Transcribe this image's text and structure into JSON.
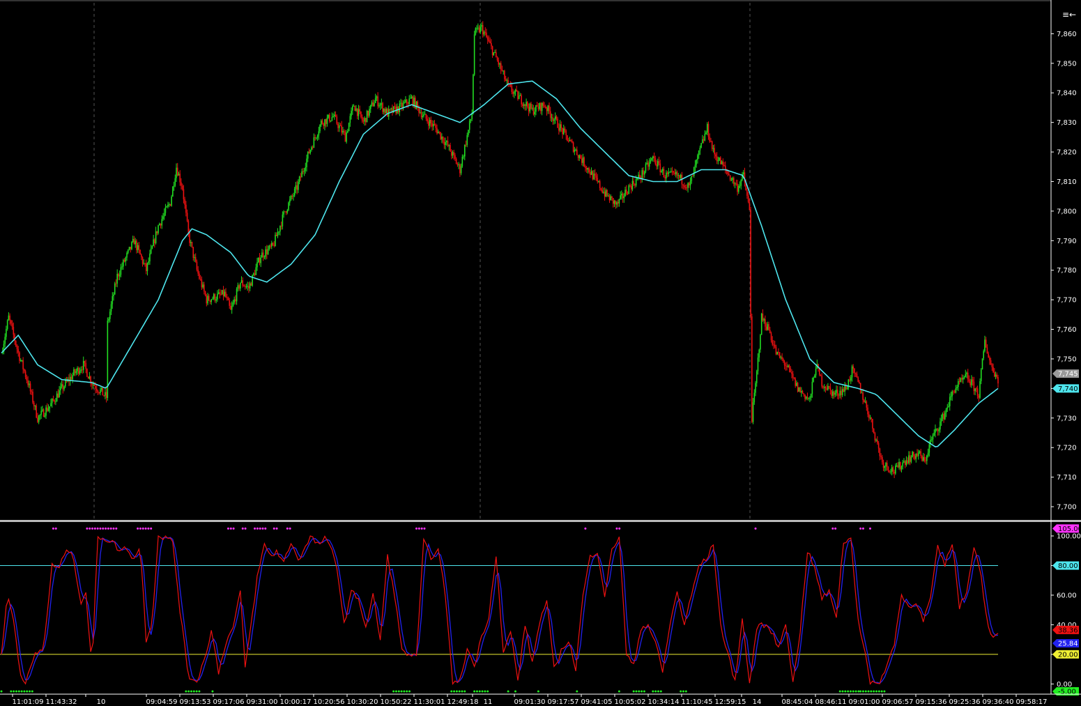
{
  "colors": {
    "background": "#000000",
    "up_candle": "#22dd22",
    "down_candle": "#ee1111",
    "moving_average": "#4ee6ee",
    "stoch_k": "#ee1111",
    "stoch_d": "#2222ee",
    "level_upper": "#4ee6ee",
    "level_lower": "#eeee33",
    "overbought_dots": "#ff33ff",
    "oversold_dots": "#22ee22",
    "separator": "#ffffff",
    "axis_text": "#ffffff",
    "vline": "#555555"
  },
  "toolbar": {
    "menu_icon": "≡←"
  },
  "chart_data": [
    {
      "type": "candlestick",
      "name": "",
      "ylim": [
        7696,
        7870
      ],
      "y_ticks": [
        "7,700",
        "7,710",
        "7,720",
        "7,730",
        "7,740",
        "7,750",
        "7,760",
        "7,770",
        "7,780",
        "7,790",
        "7,800",
        "7,810",
        "7,820",
        "7,830",
        "7,840",
        "7,850",
        "7,860"
      ],
      "y_tick_values": [
        7700,
        7710,
        7720,
        7730,
        7740,
        7750,
        7760,
        7770,
        7780,
        7790,
        7800,
        7810,
        7820,
        7830,
        7840,
        7850,
        7860
      ],
      "last_price_label": "7,745",
      "last_price_value": 7745,
      "ma_label": "7,740",
      "ma_value": 7740,
      "price_path": [
        [
          0,
          7752
        ],
        [
          6,
          7764
        ],
        [
          14,
          7752
        ],
        [
          22,
          7742
        ],
        [
          30,
          7730
        ],
        [
          40,
          7734
        ],
        [
          50,
          7740
        ],
        [
          60,
          7745
        ],
        [
          68,
          7748
        ],
        [
          75,
          7742
        ],
        [
          87,
          7737
        ],
        [
          88,
          7762
        ],
        [
          96,
          7778
        ],
        [
          110,
          7790
        ],
        [
          120,
          7780
        ],
        [
          130,
          7795
        ],
        [
          140,
          7803
        ],
        [
          145,
          7815
        ],
        [
          150,
          7808
        ],
        [
          155,
          7792
        ],
        [
          162,
          7780
        ],
        [
          170,
          7770
        ],
        [
          185,
          7772
        ],
        [
          190,
          7766
        ],
        [
          198,
          7776
        ],
        [
          205,
          7774
        ],
        [
          215,
          7785
        ],
        [
          225,
          7788
        ],
        [
          235,
          7800
        ],
        [
          245,
          7808
        ],
        [
          255,
          7820
        ],
        [
          265,
          7830
        ],
        [
          275,
          7832
        ],
        [
          285,
          7825
        ],
        [
          292,
          7836
        ],
        [
          300,
          7830
        ],
        [
          310,
          7838
        ],
        [
          320,
          7833
        ],
        [
          330,
          7835
        ],
        [
          340,
          7838
        ],
        [
          350,
          7832
        ],
        [
          360,
          7828
        ],
        [
          370,
          7822
        ],
        [
          380,
          7814
        ],
        [
          390,
          7833
        ],
        [
          392,
          7860
        ],
        [
          398,
          7862
        ],
        [
          405,
          7856
        ],
        [
          412,
          7850
        ],
        [
          420,
          7842
        ],
        [
          430,
          7838
        ],
        [
          440,
          7834
        ],
        [
          450,
          7836
        ],
        [
          460,
          7830
        ],
        [
          470,
          7824
        ],
        [
          480,
          7818
        ],
        [
          490,
          7812
        ],
        [
          500,
          7806
        ],
        [
          510,
          7802
        ],
        [
          520,
          7808
        ],
        [
          530,
          7812
        ],
        [
          540,
          7818
        ],
        [
          550,
          7812
        ],
        [
          560,
          7812
        ],
        [
          570,
          7808
        ],
        [
          580,
          7822
        ],
        [
          585,
          7828
        ],
        [
          590,
          7820
        ],
        [
          600,
          7814
        ],
        [
          610,
          7808
        ],
        [
          615,
          7812
        ],
        [
          620,
          7800
        ],
        [
          622,
          7730
        ],
        [
          626,
          7745
        ],
        [
          630,
          7764
        ],
        [
          636,
          7760
        ],
        [
          642,
          7752
        ],
        [
          650,
          7748
        ],
        [
          660,
          7740
        ],
        [
          670,
          7736
        ],
        [
          675,
          7748
        ],
        [
          680,
          7742
        ],
        [
          690,
          7738
        ],
        [
          700,
          7740
        ],
        [
          705,
          7746
        ],
        [
          710,
          7742
        ],
        [
          720,
          7730
        ],
        [
          730,
          7715
        ],
        [
          740,
          7712
        ],
        [
          750,
          7716
        ],
        [
          760,
          7718
        ],
        [
          765,
          7715
        ],
        [
          770,
          7722
        ],
        [
          780,
          7730
        ],
        [
          790,
          7740
        ],
        [
          800,
          7744
        ],
        [
          810,
          7738
        ],
        [
          815,
          7756
        ],
        [
          820,
          7748
        ],
        [
          826,
          7743
        ]
      ],
      "ma_path": [
        [
          0,
          7752
        ],
        [
          14,
          7758
        ],
        [
          30,
          7748
        ],
        [
          50,
          7743
        ],
        [
          75,
          7742
        ],
        [
          87,
          7740
        ],
        [
          110,
          7756
        ],
        [
          130,
          7770
        ],
        [
          150,
          7790
        ],
        [
          158,
          7794
        ],
        [
          170,
          7792
        ],
        [
          190,
          7786
        ],
        [
          205,
          7778
        ],
        [
          220,
          7776
        ],
        [
          240,
          7782
        ],
        [
          260,
          7792
        ],
        [
          280,
          7810
        ],
        [
          300,
          7826
        ],
        [
          320,
          7833
        ],
        [
          340,
          7836
        ],
        [
          360,
          7833
        ],
        [
          380,
          7830
        ],
        [
          400,
          7836
        ],
        [
          420,
          7843
        ],
        [
          440,
          7844
        ],
        [
          460,
          7838
        ],
        [
          480,
          7828
        ],
        [
          500,
          7820
        ],
        [
          520,
          7812
        ],
        [
          540,
          7810
        ],
        [
          560,
          7810
        ],
        [
          580,
          7814
        ],
        [
          600,
          7814
        ],
        [
          615,
          7812
        ],
        [
          630,
          7795
        ],
        [
          650,
          7770
        ],
        [
          670,
          7750
        ],
        [
          690,
          7742
        ],
        [
          710,
          7740
        ],
        [
          725,
          7738
        ],
        [
          740,
          7732
        ],
        [
          760,
          7724
        ],
        [
          775,
          7720
        ],
        [
          790,
          7726
        ],
        [
          810,
          7735
        ],
        [
          826,
          7740
        ]
      ]
    },
    {
      "type": "line",
      "name": "",
      "ylim": [
        -5,
        108
      ],
      "y_ticks": [
        "0.00",
        "20.00",
        "40.00",
        "60.00",
        "80.00",
        "100.00"
      ],
      "y_tick_values": [
        0,
        20,
        40,
        60,
        80,
        100
      ],
      "levels": [
        80,
        20
      ],
      "badges": [
        {
          "label": "105.00",
          "value": 105,
          "color": "#ff33ff"
        },
        {
          "label": "80.00",
          "value": 80,
          "color": "#4ee6ee"
        },
        {
          "label": "38.36",
          "value": 36.5,
          "color": "#ee1111"
        },
        {
          "label": "25.84",
          "value": 27.5,
          "color": "#2222ee"
        },
        {
          "label": "20.00",
          "value": 20,
          "color": "#eeee33"
        },
        {
          "label": "-5.00",
          "value": -5,
          "color": "#22ee22"
        }
      ],
      "series_k": [
        [
          0,
          20
        ],
        [
          5,
          60
        ],
        [
          10,
          45
        ],
        [
          15,
          10
        ],
        [
          20,
          0
        ],
        [
          28,
          20
        ],
        [
          35,
          24
        ],
        [
          42,
          80
        ],
        [
          48,
          78
        ],
        [
          54,
          92
        ],
        [
          60,
          84
        ],
        [
          66,
          55
        ],
        [
          70,
          62
        ],
        [
          75,
          10
        ],
        [
          80,
          100
        ],
        [
          86,
          98
        ],
        [
          92,
          96
        ],
        [
          98,
          90
        ],
        [
          104,
          92
        ],
        [
          110,
          84
        ],
        [
          115,
          94
        ],
        [
          120,
          30
        ],
        [
          125,
          42
        ],
        [
          130,
          100
        ],
        [
          136,
          99
        ],
        [
          142,
          96
        ],
        [
          148,
          50
        ],
        [
          155,
          5
        ],
        [
          162,
          2
        ],
        [
          168,
          16
        ],
        [
          174,
          36
        ],
        [
          180,
          8
        ],
        [
          186,
          28
        ],
        [
          192,
          38
        ],
        [
          198,
          62
        ],
        [
          202,
          12
        ],
        [
          206,
          34
        ],
        [
          212,
          72
        ],
        [
          218,
          94
        ],
        [
          224,
          86
        ],
        [
          228,
          90
        ],
        [
          234,
          82
        ],
        [
          240,
          96
        ],
        [
          246,
          84
        ],
        [
          252,
          92
        ],
        [
          256,
          100
        ],
        [
          262,
          94
        ],
        [
          268,
          98
        ],
        [
          274,
          90
        ],
        [
          278,
          80
        ],
        [
          284,
          40
        ],
        [
          290,
          62
        ],
        [
          296,
          58
        ],
        [
          302,
          38
        ],
        [
          308,
          60
        ],
        [
          314,
          30
        ],
        [
          320,
          86
        ],
        [
          326,
          60
        ],
        [
          332,
          22
        ],
        [
          338,
          20
        ],
        [
          344,
          18
        ],
        [
          350,
          96
        ],
        [
          356,
          86
        ],
        [
          362,
          90
        ],
        [
          368,
          60
        ],
        [
          374,
          0
        ],
        [
          380,
          2
        ],
        [
          386,
          24
        ],
        [
          392,
          12
        ],
        [
          398,
          32
        ],
        [
          404,
          46
        ],
        [
          410,
          88
        ],
        [
          416,
          20
        ],
        [
          422,
          36
        ],
        [
          428,
          2
        ],
        [
          434,
          40
        ],
        [
          440,
          14
        ],
        [
          446,
          42
        ],
        [
          452,
          56
        ],
        [
          458,
          10
        ],
        [
          464,
          22
        ],
        [
          470,
          30
        ],
        [
          476,
          10
        ],
        [
          482,
          60
        ],
        [
          488,
          86
        ],
        [
          494,
          90
        ],
        [
          500,
          60
        ],
        [
          506,
          90
        ],
        [
          512,
          100
        ],
        [
          518,
          20
        ],
        [
          524,
          12
        ],
        [
          530,
          38
        ],
        [
          536,
          40
        ],
        [
          542,
          28
        ],
        [
          548,
          8
        ],
        [
          554,
          40
        ],
        [
          560,
          62
        ],
        [
          566,
          40
        ],
        [
          572,
          60
        ],
        [
          578,
          80
        ],
        [
          584,
          84
        ],
        [
          590,
          94
        ],
        [
          596,
          40
        ],
        [
          602,
          20
        ],
        [
          608,
          2
        ],
        [
          614,
          44
        ],
        [
          620,
          0
        ],
        [
          626,
          38
        ],
        [
          632,
          40
        ],
        [
          638,
          36
        ],
        [
          644,
          24
        ],
        [
          650,
          42
        ],
        [
          656,
          0
        ],
        [
          662,
          36
        ],
        [
          668,
          90
        ],
        [
          674,
          78
        ],
        [
          680,
          58
        ],
        [
          686,
          62
        ],
        [
          692,
          46
        ],
        [
          698,
          96
        ],
        [
          704,
          98
        ],
        [
          710,
          44
        ],
        [
          716,
          20
        ],
        [
          720,
          0
        ],
        [
          724,
          0
        ],
        [
          728,
          2
        ],
        [
          734,
          12
        ],
        [
          740,
          28
        ],
        [
          746,
          60
        ],
        [
          752,
          52
        ],
        [
          758,
          56
        ],
        [
          764,
          42
        ],
        [
          770,
          58
        ],
        [
          776,
          92
        ],
        [
          782,
          80
        ],
        [
          788,
          96
        ],
        [
          794,
          52
        ],
        [
          800,
          62
        ],
        [
          806,
          94
        ],
        [
          812,
          72
        ],
        [
          818,
          38
        ],
        [
          822,
          32
        ],
        [
          826,
          36
        ]
      ],
      "overbought_dots": [
        [
          43,
          47
        ],
        [
          71,
          96
        ],
        [
          113,
          125
        ],
        [
          188,
          194
        ],
        [
          200,
          204
        ],
        [
          210,
          220
        ],
        [
          226,
          230
        ],
        [
          237,
          241
        ],
        [
          344,
          352
        ],
        [
          484,
          484
        ],
        [
          510,
          514
        ],
        [
          625,
          625
        ],
        [
          689,
          693
        ],
        [
          712,
          716
        ],
        [
          720,
          720
        ]
      ],
      "oversold_dots": [
        [
          0,
          0
        ],
        [
          8,
          26
        ],
        [
          153,
          164
        ],
        [
          175,
          175
        ],
        [
          325,
          340
        ],
        [
          373,
          384
        ],
        [
          392,
          403
        ],
        [
          420,
          420
        ],
        [
          426,
          426
        ],
        [
          445,
          445
        ],
        [
          477,
          477
        ],
        [
          512,
          512
        ],
        [
          524,
          534
        ],
        [
          540,
          547
        ],
        [
          563,
          568
        ],
        [
          695,
          712
        ],
        [
          712,
          732
        ]
      ]
    }
  ],
  "x_labels": [
    "11:01:09",
    "11:43:32",
    "10",
    "09:04:59",
    "09:13:53",
    "09:17:06",
    "09:31:00",
    "10:00:17",
    "10:20:56",
    "10:30:20",
    "10:50:22",
    "11:30:01",
    "12:49:18",
    "11",
    "09:01:30",
    "09:17:57",
    "09:41:05",
    "10:05:02",
    "10:34:14",
    "11:10:45",
    "12:59:15",
    "14",
    "08:45:04",
    "08:46:11",
    "09:01:00",
    "09:06:57",
    "09:15:36",
    "09:25:36",
    "09:36:40",
    "09:58:17"
  ]
}
